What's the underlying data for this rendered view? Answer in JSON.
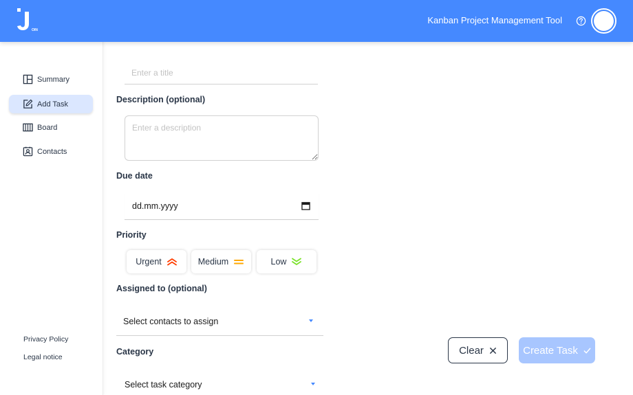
{
  "header": {
    "title": "Kanban Project Management Tool",
    "logo_text": "J",
    "logo_subtext": "OIN"
  },
  "sidebar": {
    "items": [
      {
        "label": "Summary",
        "icon": "summary-icon",
        "active": false
      },
      {
        "label": "Add Task",
        "icon": "edit-icon",
        "active": true
      },
      {
        "label": "Board",
        "icon": "board-icon",
        "active": false
      },
      {
        "label": "Contacts",
        "icon": "contacts-icon",
        "active": false
      }
    ],
    "footer": [
      "Privacy Policy",
      "Legal notice"
    ]
  },
  "form": {
    "title_placeholder": "Enter a title",
    "description_label": "Description (optional)",
    "description_placeholder": "Enter a description",
    "due_date_label": "Due date",
    "due_date_value": "dd.mm.yyyy",
    "priority_label": "Priority",
    "priorities": [
      {
        "label": "Urgent",
        "icon": "double-chevron-up-icon",
        "color": "#ff3d00"
      },
      {
        "label": "Medium",
        "icon": "equals-icon",
        "color": "#ffa800"
      },
      {
        "label": "Low",
        "icon": "double-chevron-down-icon",
        "color": "#7ae229"
      }
    ],
    "assigned_label": "Assigned to (optional)",
    "assigned_value": "Select contacts to assign",
    "category_label": "Category",
    "category_value": "Select task category"
  },
  "actions": {
    "clear_label": "Clear",
    "create_label": "Create Task"
  },
  "colors": {
    "brand": "#4589ff",
    "dark": "#2a3647",
    "active_nav": "#dbe7ff",
    "create_disabled": "#a8c6ff"
  }
}
